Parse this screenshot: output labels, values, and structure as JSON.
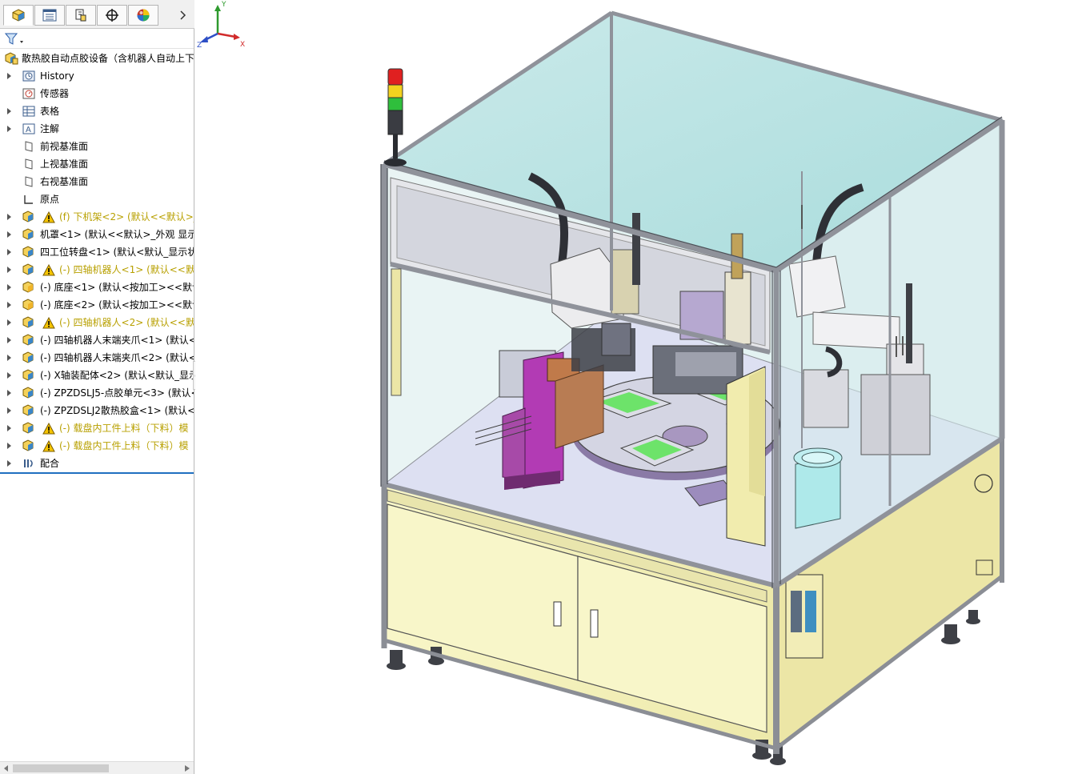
{
  "feature_manager": {
    "tabs": [
      {
        "name": "feature-manager-tab",
        "icon": "part-cube-icon",
        "active": true
      },
      {
        "name": "property-manager-tab",
        "icon": "property-list-icon",
        "active": false
      },
      {
        "name": "configuration-manager-tab",
        "icon": "configuration-icon",
        "active": false
      },
      {
        "name": "dimxpert-manager-tab",
        "icon": "crosshair-icon",
        "active": false
      },
      {
        "name": "display-manager-tab",
        "icon": "appearance-ball-icon",
        "active": false
      }
    ],
    "filter_icon": "filter-funnel-icon",
    "root_label": "散热胶自动点胶设备（含机器人自动上下",
    "items": [
      {
        "label": "History",
        "icon": "history-icon",
        "warn": false,
        "expandable": true
      },
      {
        "label": "传感器",
        "icon": "sensor-icon",
        "warn": false,
        "expandable": false
      },
      {
        "label": "表格",
        "icon": "table-icon",
        "warn": false,
        "expandable": true
      },
      {
        "label": "注解",
        "icon": "annotation-icon",
        "warn": false,
        "expandable": true
      },
      {
        "label": "前视基准面",
        "icon": "plane-icon",
        "warn": false,
        "expandable": false
      },
      {
        "label": "上视基准面",
        "icon": "plane-icon",
        "warn": false,
        "expandable": false
      },
      {
        "label": "右视基准面",
        "icon": "plane-icon",
        "warn": false,
        "expandable": false
      },
      {
        "label": "原点",
        "icon": "origin-icon",
        "warn": false,
        "expandable": false
      },
      {
        "label": "(f) 下机架<2> (默认<<默认>_",
        "icon": "subassembly-icon",
        "warn": true,
        "expandable": true
      },
      {
        "label": "机罩<1> (默认<<默认>_外观 显示",
        "icon": "subassembly-icon",
        "warn": false,
        "expandable": true
      },
      {
        "label": "四工位转盘<1> (默认<默认_显示状",
        "icon": "subassembly-icon",
        "warn": false,
        "expandable": true
      },
      {
        "label": "(-) 四轴机器人<1> (默认<<默",
        "icon": "subassembly-icon",
        "warn": true,
        "expandable": true
      },
      {
        "label": "(-) 底座<1> (默认<按加工><<默认",
        "icon": "part-icon",
        "warn": false,
        "expandable": true
      },
      {
        "label": "(-) 底座<2> (默认<按加工><<默认",
        "icon": "part-icon",
        "warn": false,
        "expandable": true
      },
      {
        "label": "(-) 四轴机器人<2> (默认<<默",
        "icon": "subassembly-icon",
        "warn": true,
        "expandable": true
      },
      {
        "label": "(-) 四轴机器人末端夹爪<1> (默认<",
        "icon": "subassembly-icon",
        "warn": false,
        "expandable": true
      },
      {
        "label": "(-) 四轴机器人末端夹爪<2> (默认<",
        "icon": "subassembly-icon",
        "warn": false,
        "expandable": true
      },
      {
        "label": "(-) X轴装配体<2> (默认<默认_显示",
        "icon": "subassembly-icon",
        "warn": false,
        "expandable": true
      },
      {
        "label": "(-) ZPZDSLJ5-点胶单元<3> (默认<",
        "icon": "subassembly-icon",
        "warn": false,
        "expandable": true
      },
      {
        "label": "(-) ZPZDSLJ2散热胶盒<1> (默认<持",
        "icon": "subassembly-icon",
        "warn": false,
        "expandable": true
      },
      {
        "label": "(-) 载盘内工件上料（下料）模",
        "icon": "subassembly-icon",
        "warn": true,
        "expandable": true
      },
      {
        "label": "(-) 载盘内工件上料（下料）模",
        "icon": "subassembly-icon",
        "warn": true,
        "expandable": true
      },
      {
        "label": "配合",
        "icon": "mates-icon",
        "warn": false,
        "expandable": true
      }
    ]
  },
  "colors": {
    "frame": "#c9cbd0",
    "frame_dark": "#7d8088",
    "glass": "#bfe4e4",
    "base_panel": "#f5f2bf",
    "floor": "#dde0f2",
    "tree_warn": "#b8a000",
    "selection_line": "#1f6fc0"
  },
  "triad": {
    "x_label": "X",
    "y_label": "Y",
    "z_label": "Z"
  }
}
